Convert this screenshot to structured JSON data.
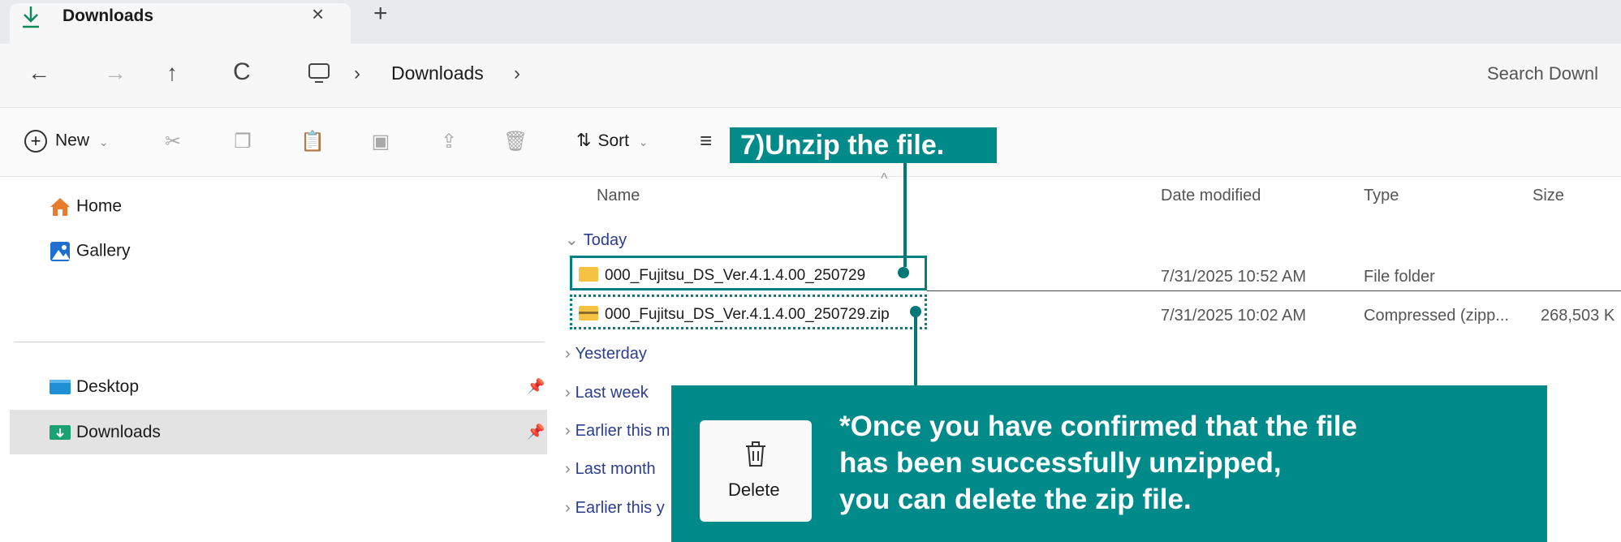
{
  "window": {
    "tab_title": "Downloads",
    "tab_close": "×",
    "new_tab": "+"
  },
  "address_bar": {
    "back": "←",
    "forward": "→",
    "up": "↑",
    "refresh": "C",
    "separator": "›",
    "breadcrumb": "Downloads",
    "search_placeholder": "Search Downl"
  },
  "command_bar": {
    "new_label": "New",
    "sort_label": "Sort",
    "chevron": "⌄"
  },
  "sidebar": {
    "items": [
      {
        "label": "Home",
        "icon": "home-icon"
      },
      {
        "label": "Gallery",
        "icon": "gallery-icon"
      },
      {
        "label": "Desktop",
        "icon": "desktop-folder-icon",
        "pinned": true
      },
      {
        "label": "Downloads",
        "icon": "downloads-folder-icon",
        "pinned": true,
        "selected": true
      }
    ]
  },
  "file_list": {
    "columns": [
      "Name",
      "Date modified",
      "Type",
      "Size"
    ],
    "groups": {
      "today": "Today",
      "yesterday": "Yesterday",
      "last_week": "Last week",
      "earlier_month": "Earlier this m",
      "last_month": "Last month",
      "earlier_year": "Earlier this y"
    },
    "rows": [
      {
        "name": "000_Fujitsu_DS_Ver.4.1.4.00_250729",
        "date": "7/31/2025 10:52 AM",
        "type": "File folder",
        "size": "",
        "icon": "folder-icon"
      },
      {
        "name": "000_Fujitsu_DS_Ver.4.1.4.00_250729.zip",
        "date": "7/31/2025 10:02 AM",
        "type": "Compressed (zipp...",
        "size": "268,503 K",
        "icon": "zip-folder-icon"
      }
    ]
  },
  "context_menu": {
    "delete_label": "Delete"
  },
  "annotations": {
    "step": "7)Unzip the file.",
    "note_line1": "*Once you have confirmed that the file",
    "note_line2": "has been successfully unzipped,",
    "note_line3": "you can delete the zip file.",
    "accent_color": "#008a8a"
  }
}
